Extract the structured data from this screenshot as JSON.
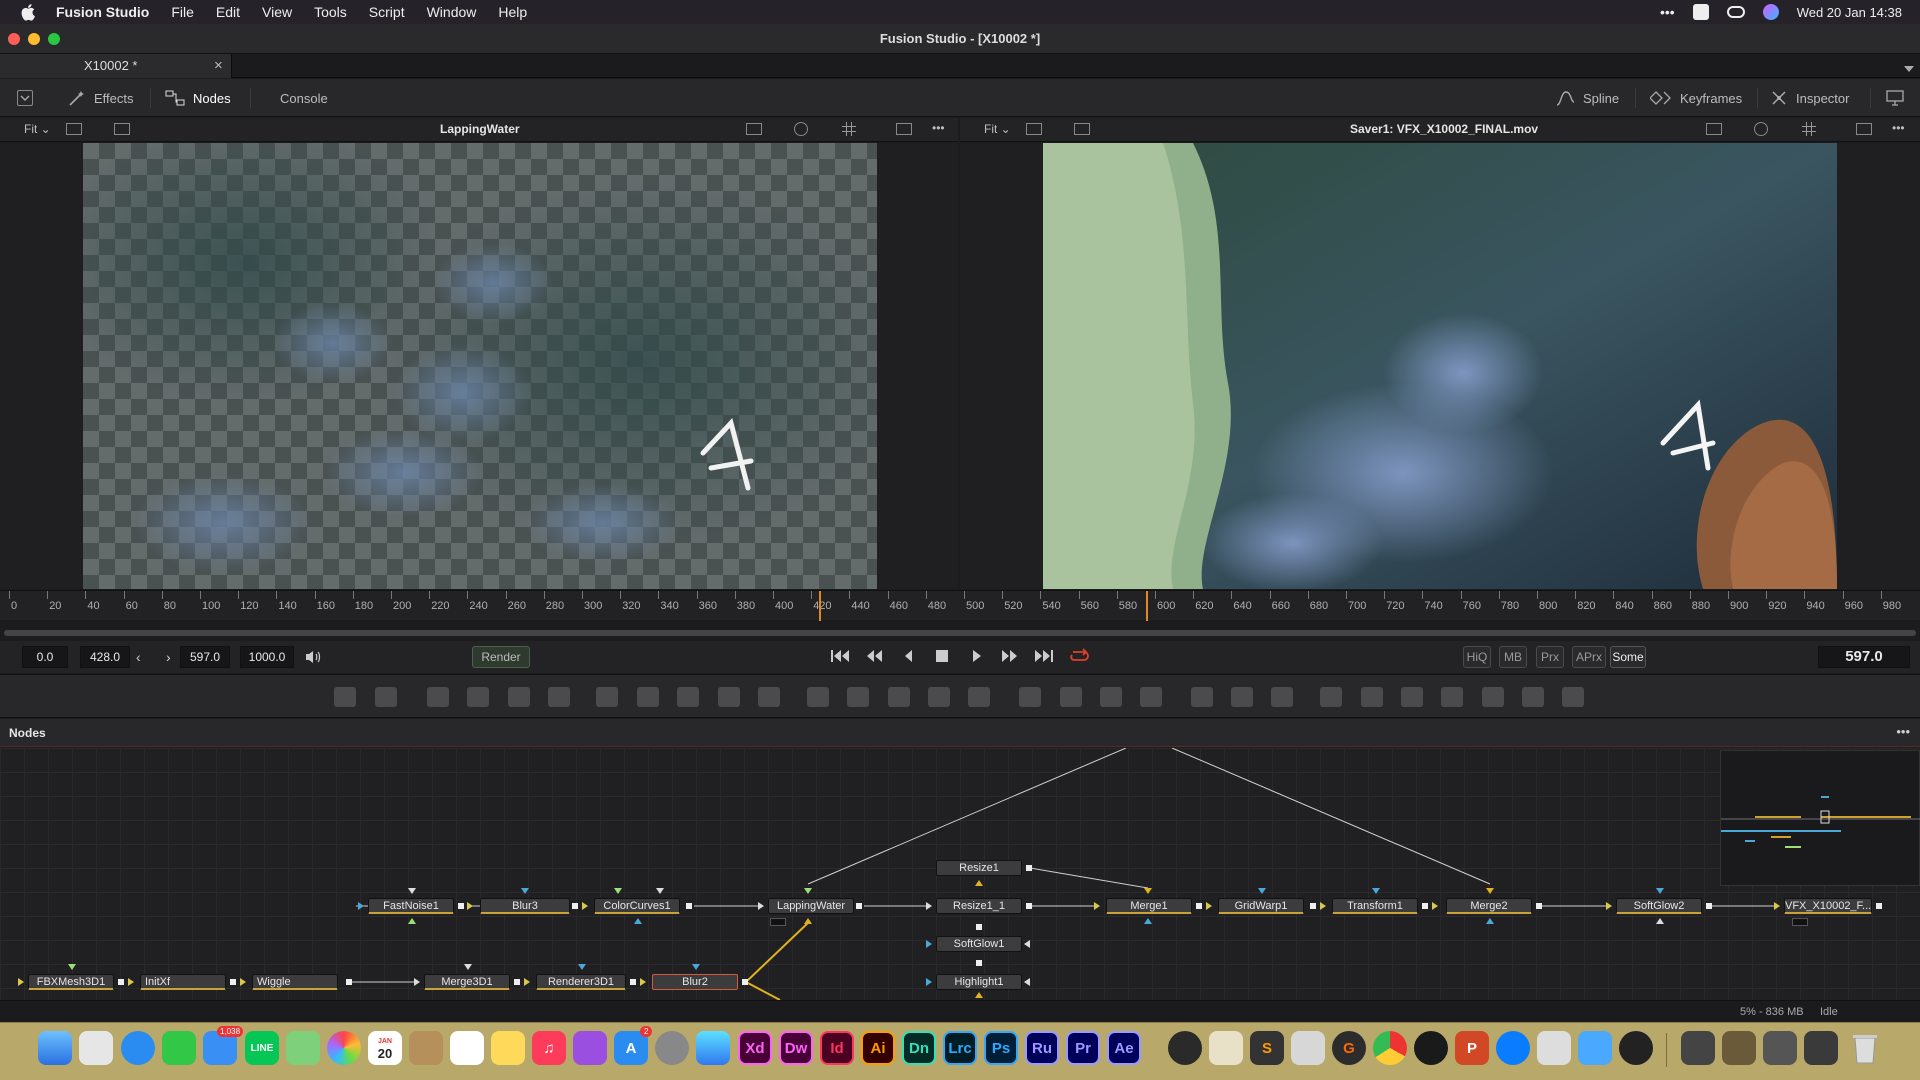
{
  "menubar": {
    "app_name": "Fusion Studio",
    "menus": [
      "File",
      "Edit",
      "View",
      "Tools",
      "Script",
      "Window",
      "Help"
    ],
    "clock": "Wed 20 Jan  14:38"
  },
  "window": {
    "title": "Fusion Studio - [X10002 *]"
  },
  "doc_tab": {
    "label": "X10002 *",
    "close": "×"
  },
  "toolbar": {
    "effects": "Effects",
    "nodes": "Nodes",
    "console": "Console",
    "spline": "Spline",
    "keyframes": "Keyframes",
    "inspector": "Inspector"
  },
  "viewer_left": {
    "fit": "Fit",
    "title": "LappingWater",
    "more": "•••"
  },
  "viewer_right": {
    "fit": "Fit",
    "title": "Saver1: VFX_X10002_FINAL.mov",
    "more": "•••"
  },
  "ruler": {
    "labels": [
      "0",
      "20",
      "40",
      "60",
      "80",
      "100",
      "120",
      "140",
      "160",
      "180",
      "200",
      "220",
      "240",
      "260",
      "280",
      "300",
      "320",
      "340",
      "360",
      "380",
      "400",
      "420",
      "440",
      "460",
      "480",
      "500",
      "520",
      "540",
      "560",
      "580",
      "600",
      "620",
      "640",
      "660",
      "680",
      "700",
      "720",
      "740",
      "760",
      "780",
      "800",
      "820",
      "840",
      "860",
      "880",
      "900",
      "920",
      "940",
      "960",
      "980"
    ],
    "playhead_a": 428,
    "playhead_b": 597
  },
  "transport": {
    "global_start": "0.0",
    "render_start": "428.0",
    "render_end": "597.0",
    "global_end": "1000.0",
    "render_button": "Render",
    "hiq": "HiQ",
    "mb": "MB",
    "prx": "Prx",
    "aprx": "APrx",
    "some": "Some",
    "current_time": "597.0"
  },
  "nodes_panel": {
    "title": "Nodes",
    "more": "•••",
    "nodes": {
      "fastnoise": "FastNoise1",
      "blur3": "Blur3",
      "colorcurves": "ColorCurves1",
      "lapping": "LappingWater",
      "resize1": "Resize1",
      "resize1_1": "Resize1_1",
      "softglow1": "SoftGlow1",
      "highlight1": "Highlight1",
      "merge1": "Merge1",
      "gridwarp": "GridWarp1",
      "transform1": "Transform1",
      "merge2": "Merge2",
      "softglow2": "SoftGlow2",
      "vfx": "VFX_X10002_F...",
      "fbxmesh": "FBXMesh3D1",
      "initxf": "InitXf",
      "wiggle": "Wiggle",
      "merge3d": "Merge3D1",
      "renderer3d": "Renderer3D1",
      "blur2": "Blur2"
    }
  },
  "status": {
    "memory": "5% - 836 MB",
    "state": "Idle"
  },
  "dock": {
    "apps": [
      "Xd",
      "Dw",
      "Id",
      "Ai",
      "Dn",
      "Lrc",
      "Ps",
      "Ru",
      "Pr",
      "Ae"
    ],
    "colors": {
      "Xd": "#470137",
      "Dw": "#470137",
      "Id": "#49021f",
      "Ai": "#330000",
      "Dn": "#062a26",
      "Lrc": "#001d26",
      "Ps": "#001e36",
      "Ru": "#00005b",
      "Pr": "#00005b",
      "Ae": "#00005b"
    },
    "text_colors": {
      "Xd": "#ff61f6",
      "Dw": "#ff61f6",
      "Id": "#ff3366",
      "Ai": "#ff9a00",
      "Dn": "#33e0b8",
      "Lrc": "#31a8ff",
      "Ps": "#31a8ff",
      "Ru": "#9999ff",
      "Pr": "#9999ff",
      "Ae": "#9999ff"
    },
    "calendar_month": "JAN",
    "calendar_day": "20",
    "mail_badge": "1,038",
    "store_badge": "2"
  },
  "colors": {
    "accent_playhead": "#e08a1e",
    "loop_red": "#e0402a",
    "node_gold": "#c9a23a"
  }
}
